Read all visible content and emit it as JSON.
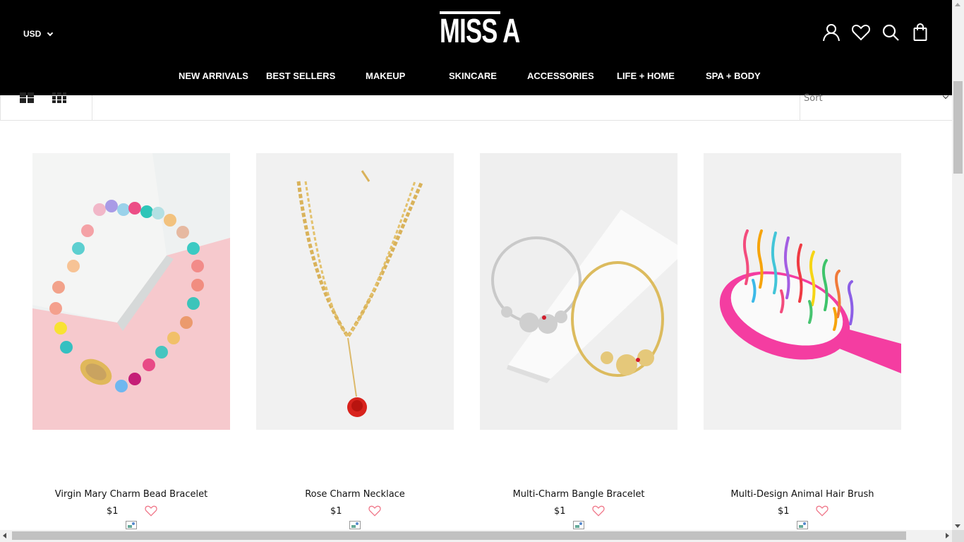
{
  "header": {
    "currency": "USD",
    "logo_text": "MISS A",
    "icons": [
      "account-icon",
      "wishlist-icon",
      "search-icon",
      "cart-icon"
    ]
  },
  "nav": {
    "items": [
      "NEW ARRIVALS",
      "BEST SELLERS",
      "MAKEUP",
      "SKINCARE",
      "ACCESSORIES",
      "LIFE + HOME",
      "SPA + BODY"
    ]
  },
  "toolbar": {
    "sort_label": "Sort"
  },
  "products": [
    {
      "title": "Virgin Mary Charm Bead Bracelet",
      "price": "$1"
    },
    {
      "title": "Rose Charm Necklace",
      "price": "$1"
    },
    {
      "title": "Multi-Charm Bangle Bracelet",
      "price": "$1"
    },
    {
      "title": "Multi-Design Animal Hair Brush",
      "price": "$1"
    }
  ],
  "colors": {
    "header_bg": "#000000",
    "accent_heart": "#f07a8c",
    "text": "#111111"
  }
}
